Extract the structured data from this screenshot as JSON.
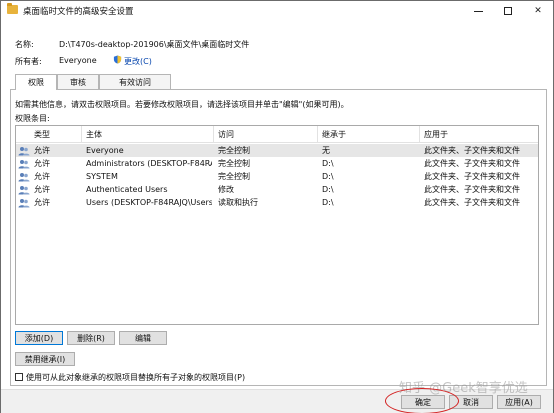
{
  "window": {
    "title": "桌面临时文件的高级安全设置"
  },
  "info": {
    "name_label": "名称:",
    "name_value": "D:\\T470s-deaktop-201906\\桌面文件\\桌面临时文件",
    "owner_label": "所有者:",
    "owner_value": "Everyone",
    "change_link": "更改(C)"
  },
  "tabs": [
    {
      "label": "权限",
      "active": true
    },
    {
      "label": "审核",
      "active": false
    },
    {
      "label": "有效访问",
      "active": false
    }
  ],
  "instructions": "如需其他信息，请双击权限项目。若要修改权限项目，请选择该项目并单击\"编辑\"(如果可用)。",
  "entries_label": "权限条目:",
  "table": {
    "headers": [
      "类型",
      "主体",
      "访问",
      "继承于",
      "应用于"
    ],
    "rows": [
      {
        "type": "允许",
        "principal": "Everyone",
        "access": "完全控制",
        "inherited": "无",
        "applies": "此文件夹、子文件夹和文件",
        "selected": true
      },
      {
        "type": "允许",
        "principal": "Administrators (DESKTOP-F84RA...",
        "access": "完全控制",
        "inherited": "D:\\",
        "applies": "此文件夹、子文件夹和文件",
        "selected": false
      },
      {
        "type": "允许",
        "principal": "SYSTEM",
        "access": "完全控制",
        "inherited": "D:\\",
        "applies": "此文件夹、子文件夹和文件",
        "selected": false
      },
      {
        "type": "允许",
        "principal": "Authenticated Users",
        "access": "修改",
        "inherited": "D:\\",
        "applies": "此文件夹、子文件夹和文件",
        "selected": false
      },
      {
        "type": "允许",
        "principal": "Users (DESKTOP-F84RAJQ\\Users)",
        "access": "读取和执行",
        "inherited": "D:\\",
        "applies": "此文件夹、子文件夹和文件",
        "selected": false
      }
    ]
  },
  "buttons": {
    "add": "添加(D)",
    "remove": "删除(R)",
    "edit": "编辑",
    "disable_inheritance": "禁用继承(I)",
    "ok": "确定",
    "cancel": "取消",
    "apply": "应用(A)"
  },
  "checkbox": {
    "label": "使用可从此对象继承的权限项目替换所有子对象的权限项目(P)",
    "checked": false
  },
  "watermark": "知乎 @Geek智享优选",
  "colors": {
    "link": "#0645ad",
    "selected_row": "#e6e6e6",
    "highlight_circle": "#d32020"
  }
}
